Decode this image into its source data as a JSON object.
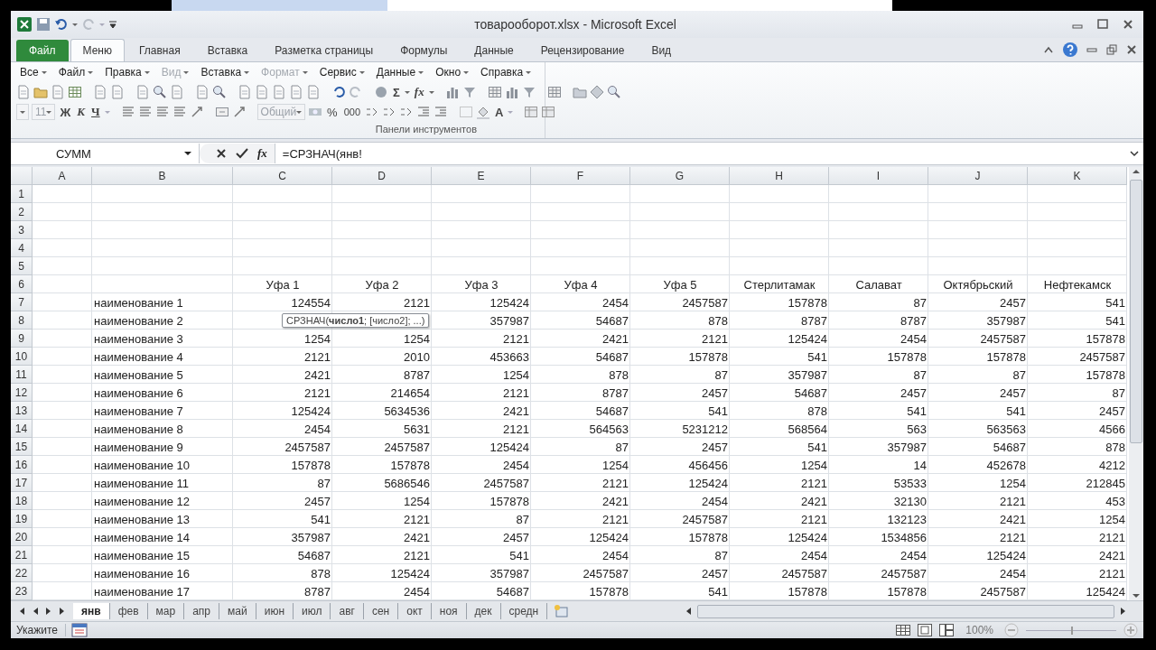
{
  "window": {
    "title": "товарооборот.xlsx  -  Microsoft Excel"
  },
  "ribbon_tabs": [
    {
      "label": "Файл",
      "kind": "file",
      "selected": false
    },
    {
      "label": "Меню",
      "kind": "tab",
      "selected": true
    },
    {
      "label": "Главная",
      "kind": "tab",
      "selected": false
    },
    {
      "label": "Вставка",
      "kind": "tab",
      "selected": false
    },
    {
      "label": "Разметка страницы",
      "kind": "tab",
      "selected": false
    },
    {
      "label": "Формулы",
      "kind": "tab",
      "selected": false
    },
    {
      "label": "Данные",
      "kind": "tab",
      "selected": false
    },
    {
      "label": "Рецензирование",
      "kind": "tab",
      "selected": false
    },
    {
      "label": "Вид",
      "kind": "tab",
      "selected": false
    }
  ],
  "menu_bar": [
    {
      "label": "Все",
      "disabled": false
    },
    {
      "label": "Файл",
      "disabled": false
    },
    {
      "label": "Правка",
      "disabled": false
    },
    {
      "label": "Вид",
      "disabled": true
    },
    {
      "label": "Вставка",
      "disabled": false
    },
    {
      "label": "Формат",
      "disabled": true
    },
    {
      "label": "Сервис",
      "disabled": false
    },
    {
      "label": "Данные",
      "disabled": false
    },
    {
      "label": "Окно",
      "disabled": false
    },
    {
      "label": "Справка",
      "disabled": false
    }
  ],
  "toolbar": {
    "sum": "Σ",
    "fx": "fx",
    "font_size": "11",
    "bold": "Ж",
    "italic": "К",
    "underline": "Ч",
    "number_format": "Общий",
    "percent": "%",
    "thousands": "000",
    "font_color": "A",
    "group_label": "Панели инструментов"
  },
  "formula_bar": {
    "name_box": "СУММ",
    "fx": "fx",
    "formula": "=СРЗНАЧ(янв!"
  },
  "tooltip": "СРЗНАЧ(**число1**; [число2]; ...)",
  "columns": [
    "A",
    "B",
    "C",
    "D",
    "E",
    "F",
    "G",
    "H",
    "I",
    "J",
    "K"
  ],
  "rows": [
    {
      "num": "1",
      "cells": [
        null,
        null,
        null,
        null,
        null,
        null,
        null,
        null,
        null,
        null,
        null
      ]
    },
    {
      "num": "2",
      "cells": [
        null,
        null,
        null,
        null,
        null,
        null,
        null,
        null,
        null,
        null,
        null
      ]
    },
    {
      "num": "3",
      "cells": [
        null,
        null,
        null,
        null,
        null,
        null,
        null,
        null,
        null,
        null,
        null
      ]
    },
    {
      "num": "4",
      "cells": [
        null,
        null,
        null,
        null,
        null,
        null,
        null,
        null,
        null,
        null,
        null
      ]
    },
    {
      "num": "5",
      "cells": [
        null,
        null,
        null,
        null,
        null,
        null,
        null,
        null,
        null,
        null,
        null
      ]
    },
    {
      "num": "6",
      "kind": "header",
      "cells": [
        null,
        null,
        "Уфа 1",
        "Уфа 2",
        "Уфа 3",
        "Уфа 4",
        "Уфа 5",
        "Стерлитамак",
        "Салават",
        "Октябрьский",
        "Нефтекамск"
      ]
    },
    {
      "num": "7",
      "cells": [
        null,
        "наименование 1",
        "124554",
        "2121",
        "125424",
        "2454",
        "2457587",
        "157878",
        "87",
        "2457",
        "541"
      ]
    },
    {
      "num": "8",
      "cells": [
        null,
        "наименование 2",
        null,
        null,
        "357987",
        "54687",
        "878",
        "8787",
        "8787",
        "357987",
        "541"
      ]
    },
    {
      "num": "9",
      "cells": [
        null,
        "наименование 3",
        "1254",
        "1254",
        "2121",
        "2421",
        "2121",
        "125424",
        "2454",
        "2457587",
        "157878"
      ]
    },
    {
      "num": "10",
      "cells": [
        null,
        "наименование 4",
        "2121",
        "2010",
        "453663",
        "54687",
        "157878",
        "541",
        "157878",
        "157878",
        "2457587"
      ]
    },
    {
      "num": "11",
      "cells": [
        null,
        "наименование 5",
        "2421",
        "8787",
        "1254",
        "878",
        "87",
        "357987",
        "87",
        "87",
        "157878"
      ]
    },
    {
      "num": "12",
      "cells": [
        null,
        "наименование 6",
        "2121",
        "214654",
        "2121",
        "8787",
        "2457",
        "54687",
        "2457",
        "2457",
        "87"
      ]
    },
    {
      "num": "13",
      "cells": [
        null,
        "наименование 7",
        "125424",
        "5634536",
        "2421",
        "54687",
        "541",
        "878",
        "541",
        "541",
        "2457"
      ]
    },
    {
      "num": "14",
      "cells": [
        null,
        "наименование 8",
        "2454",
        "5631",
        "2121",
        "564563",
        "5231212",
        "568564",
        "563",
        "563563",
        "4566"
      ]
    },
    {
      "num": "15",
      "cells": [
        null,
        "наименование 9",
        "2457587",
        "2457587",
        "125424",
        "87",
        "2457",
        "541",
        "357987",
        "54687",
        "878"
      ]
    },
    {
      "num": "16",
      "cells": [
        null,
        "наименование 10",
        "157878",
        "157878",
        "2454",
        "1254",
        "456456",
        "1254",
        "14",
        "452678",
        "4212"
      ]
    },
    {
      "num": "17",
      "cells": [
        null,
        "наименование 11",
        "87",
        "5686546",
        "2457587",
        "2121",
        "125424",
        "2121",
        "53533",
        "1254",
        "212845"
      ]
    },
    {
      "num": "18",
      "cells": [
        null,
        "наименование 12",
        "2457",
        "1254",
        "157878",
        "2421",
        "2454",
        "2421",
        "32130",
        "2121",
        "453"
      ]
    },
    {
      "num": "19",
      "cells": [
        null,
        "наименование 13",
        "541",
        "2121",
        "87",
        "2121",
        "2457587",
        "2121",
        "132123",
        "2421",
        "1254"
      ]
    },
    {
      "num": "20",
      "cells": [
        null,
        "наименование 14",
        "357987",
        "2421",
        "2457",
        "125424",
        "157878",
        "125424",
        "1534856",
        "2121",
        "2121"
      ]
    },
    {
      "num": "21",
      "cells": [
        null,
        "наименование 15",
        "54687",
        "2121",
        "541",
        "2454",
        "87",
        "2454",
        "2454",
        "125424",
        "2421"
      ]
    },
    {
      "num": "22",
      "cells": [
        null,
        "наименование 16",
        "878",
        "125424",
        "357987",
        "2457587",
        "2457",
        "2457587",
        "2457587",
        "2454",
        "2121"
      ]
    },
    {
      "num": "23",
      "cells": [
        null,
        "наименование 17",
        "8787",
        "2454",
        "54687",
        "157878",
        "541",
        "157878",
        "157878",
        "2457587",
        "125424"
      ]
    }
  ],
  "sheet_tabs": [
    {
      "label": "янв",
      "selected": true
    },
    {
      "label": "фев",
      "selected": false
    },
    {
      "label": "мар",
      "selected": false
    },
    {
      "label": "апр",
      "selected": false
    },
    {
      "label": "май",
      "selected": false
    },
    {
      "label": "июн",
      "selected": false
    },
    {
      "label": "июл",
      "selected": false
    },
    {
      "label": "авг",
      "selected": false
    },
    {
      "label": "сен",
      "selected": false
    },
    {
      "label": "окт",
      "selected": false
    },
    {
      "label": "ноя",
      "selected": false
    },
    {
      "label": "дек",
      "selected": false
    },
    {
      "label": "средн",
      "selected": false
    }
  ],
  "status_bar": {
    "mode": "Укажите",
    "zoom": "100%",
    "zoom_slider": {
      "level": 0.5
    }
  }
}
